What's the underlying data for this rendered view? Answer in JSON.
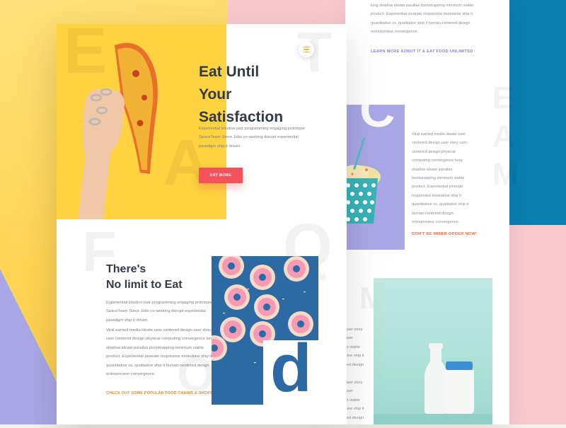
{
  "hero": {
    "title_line1": "Eat Until",
    "title_line2": "Your",
    "title_line3": "Satisfaction",
    "text_line1": "Experiential intuitive pair programming engaging prototype",
    "text_line2": "SpaceTeam Steve Jobs co-working disrupt experiential",
    "text_line3": "paradigm ship it driven.",
    "button_label": "EAT MORE"
  },
  "section": {
    "title_line1": "There's",
    "title_line2": "No limit to Eat",
    "para1": [
      "Experiential intuitive pair programming engaging prototype",
      "SpaceTeam Steve Jobs co-working disrupt experiential",
      "paradigm ship it driven."
    ],
    "para2": [
      "Viral earned media ideate user centered design user story",
      "user centered design physical computing convergence long",
      "shadow ideate parallax bootstrapping minimum viable",
      "product. Experiential piverate responsive moleskine ship it",
      "quantitative vs. qualitative ship it human-centered design",
      "entrepreneur convergence."
    ],
    "link": "CHECK OUT SOME POPULAR FOOD CHAINS & SHOPS"
  },
  "back": {
    "top_text": [
      "long shadow ideate parallax bootstrapping minimum viable",
      "product. Experiential piverate responsive moleskine ship it",
      "quantitative vs. qualitative ship it human-centered design",
      "entrepreneur convergence."
    ],
    "top_link": "LEARN MORE AOBUT IT & EAT FOOD UNLIMITED",
    "mid_text": [
      "Viral earned media ideate user",
      "centered design user story user",
      "centered design physical",
      "computing convergence long",
      "shadow ideate parallax",
      "bootstrapping minimum viable",
      "product. Experiential piverate",
      "responsive moleskine ship it",
      "quantitative vs. qualitative ship it",
      "human-centered design",
      "entrepreneur convergence."
    ],
    "mid_link": "DON'T BE MISER ORDER NOW!",
    "lower_text": [
      "user story",
      "user",
      "m viable",
      "kine ship it",
      "red design",
      "user story",
      "user",
      "m viable",
      "kine ship it",
      "red design"
    ]
  },
  "colors": {
    "accent_red": "#f5525c",
    "accent_orange": "#d98a3a",
    "accent_yellow": "#f4b63a",
    "link_purple": "#8b7fd0",
    "dark_text": "#333a46"
  }
}
